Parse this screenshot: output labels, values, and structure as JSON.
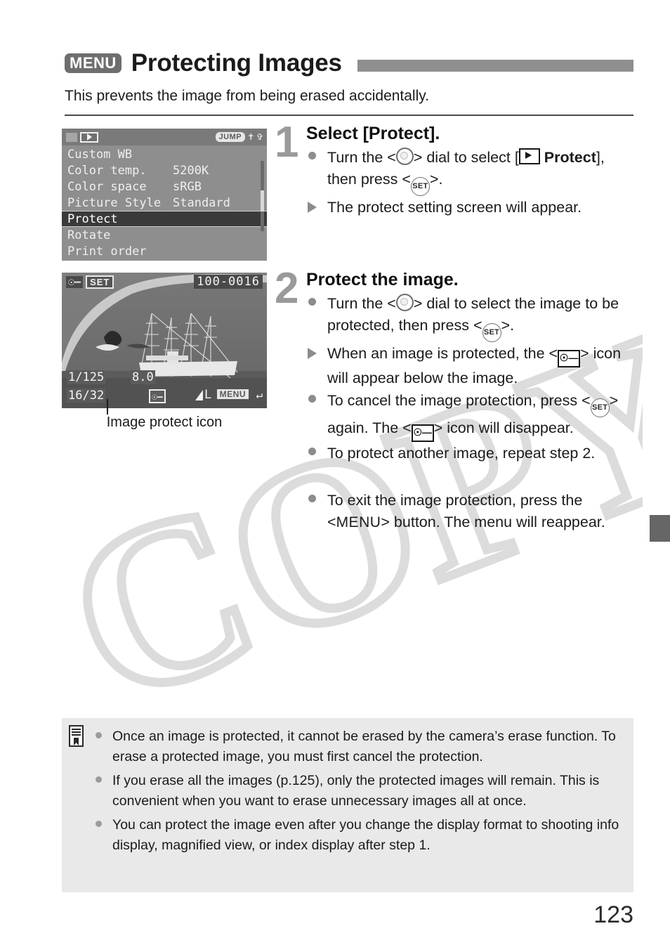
{
  "header": {
    "menu_badge": "MENU",
    "title": "Protecting Images",
    "intro": "This prevents the image from being erased accidentally."
  },
  "menu_screen": {
    "jump_badge": "JUMP",
    "wrench_icon": "wrench-icon",
    "flag_icon": "flag-icon",
    "playback_tab_icon": "playback-tab-icon",
    "rows": [
      {
        "label": "Custom WB",
        "value": ""
      },
      {
        "label": "Color temp.",
        "value": "5200K"
      },
      {
        "label": "Color space",
        "value": "sRGB"
      },
      {
        "label": "Picture Style",
        "value": "Standard"
      },
      {
        "label": "Protect",
        "value": ""
      },
      {
        "label": "Rotate",
        "value": ""
      },
      {
        "label": "Print order",
        "value": ""
      }
    ],
    "selected_index": 4
  },
  "playback_screen": {
    "protect_key_icon": "key-icon",
    "set_badge": "SET",
    "file_number": "100-0016",
    "shutter_speed": "1/125",
    "aperture": "8.0",
    "image_count": "16/32",
    "protect_icon": "image-protect-icon",
    "quality": "L",
    "menu_badge": "MENU",
    "return_icon": "return-arrow-icon",
    "caption": "Image protect icon"
  },
  "steps": [
    {
      "number": "1",
      "title": "Select [Protect].",
      "bullets": [
        {
          "type": "dot",
          "parts": [
            {
              "t": "text",
              "v": "Turn the <"
            },
            {
              "t": "icon",
              "v": "dial-icon"
            },
            {
              "t": "text",
              "v": "> dial to select ["
            },
            {
              "t": "icon",
              "v": "playback-icon"
            },
            {
              "t": "text",
              "v": " "
            },
            {
              "t": "bold",
              "v": "Protect"
            },
            {
              "t": "text",
              "v": "], then press <"
            },
            {
              "t": "icon",
              "v": "set-icon"
            },
            {
              "t": "text",
              "v": ">."
            }
          ]
        },
        {
          "type": "triangle",
          "parts": [
            {
              "t": "text",
              "v": "The protect setting screen will appear."
            }
          ]
        }
      ]
    },
    {
      "number": "2",
      "title": "Protect the image.",
      "bullets": [
        {
          "type": "dot",
          "parts": [
            {
              "t": "text",
              "v": "Turn the <"
            },
            {
              "t": "icon",
              "v": "dial-icon"
            },
            {
              "t": "text",
              "v": "> dial to select the image to be protected, then press <"
            },
            {
              "t": "icon",
              "v": "set-icon"
            },
            {
              "t": "text",
              "v": ">."
            }
          ]
        },
        {
          "type": "triangle",
          "parts": [
            {
              "t": "text",
              "v": "When an image is protected, the <"
            },
            {
              "t": "icon",
              "v": "protect-icon"
            },
            {
              "t": "text",
              "v": "> icon will appear below the image."
            }
          ]
        },
        {
          "type": "dot",
          "parts": [
            {
              "t": "text",
              "v": "To cancel the image protection, press <"
            },
            {
              "t": "icon",
              "v": "set-icon"
            },
            {
              "t": "text",
              "v": "> again. The <"
            },
            {
              "t": "icon",
              "v": "protect-icon"
            },
            {
              "t": "text",
              "v": "> icon will disappear."
            }
          ]
        },
        {
          "type": "dot",
          "parts": [
            {
              "t": "text",
              "v": "To protect another image, repeat step 2."
            }
          ]
        },
        {
          "type": "dot",
          "spacer_before": true,
          "parts": [
            {
              "t": "text",
              "v": "To exit the image protection, press the <"
            },
            {
              "t": "menuword",
              "v": "MENU"
            },
            {
              "t": "text",
              "v": "> button. The menu will reappear."
            }
          ]
        }
      ]
    }
  ],
  "note_box": {
    "icon": "note-icon",
    "items": [
      "Once an image is protected, it cannot be erased by the camera’s erase function. To erase a protected image, you must first cancel the protection.",
      "If you erase all the images (p.125), only the protected images will remain. This is convenient when you want to erase unnecessary images all at once.",
      "You can protect the image even after you change the display format to shooting info display, magnified view, or index display after step 1."
    ]
  },
  "watermark": "COPY",
  "page_number": "123",
  "colors": {
    "title_rule": "#8f8f8f",
    "menu_badge_bg": "#6e6e6e",
    "step_number": "#9a9a9a",
    "note_bg": "#e9e9e9",
    "edge_tab": "#666666",
    "watermark_stroke": "#dcdcdc"
  }
}
